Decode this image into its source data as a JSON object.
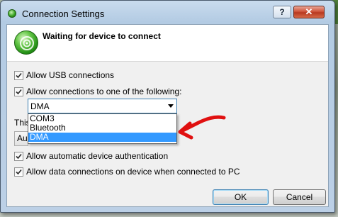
{
  "window": {
    "title": "Connection Settings",
    "help_label": "?",
    "close_label": "✕"
  },
  "status": {
    "title": "Waiting for device to connect",
    "icon": "connection-status-icon"
  },
  "options": {
    "allow_usb": {
      "label": "Allow USB connections",
      "checked": true
    },
    "allow_one_of": {
      "label": "Allow connections to one of the following:",
      "checked": true
    },
    "auto_auth": {
      "label": "Allow automatic device authentication",
      "checked": true
    },
    "data_connections": {
      "label": "Allow data connections on device when connected to PC",
      "checked": true
    }
  },
  "connection_combo": {
    "selected": "DMA",
    "options": [
      "COM3",
      "Bluetooth",
      "DMA"
    ]
  },
  "obscured": {
    "text_fragment": "This",
    "field_fragment": "Au"
  },
  "buttons": {
    "ok": "OK",
    "cancel": "Cancel"
  },
  "colors": {
    "selection": "#3399ff",
    "annotation_arrow": "#e01010"
  }
}
